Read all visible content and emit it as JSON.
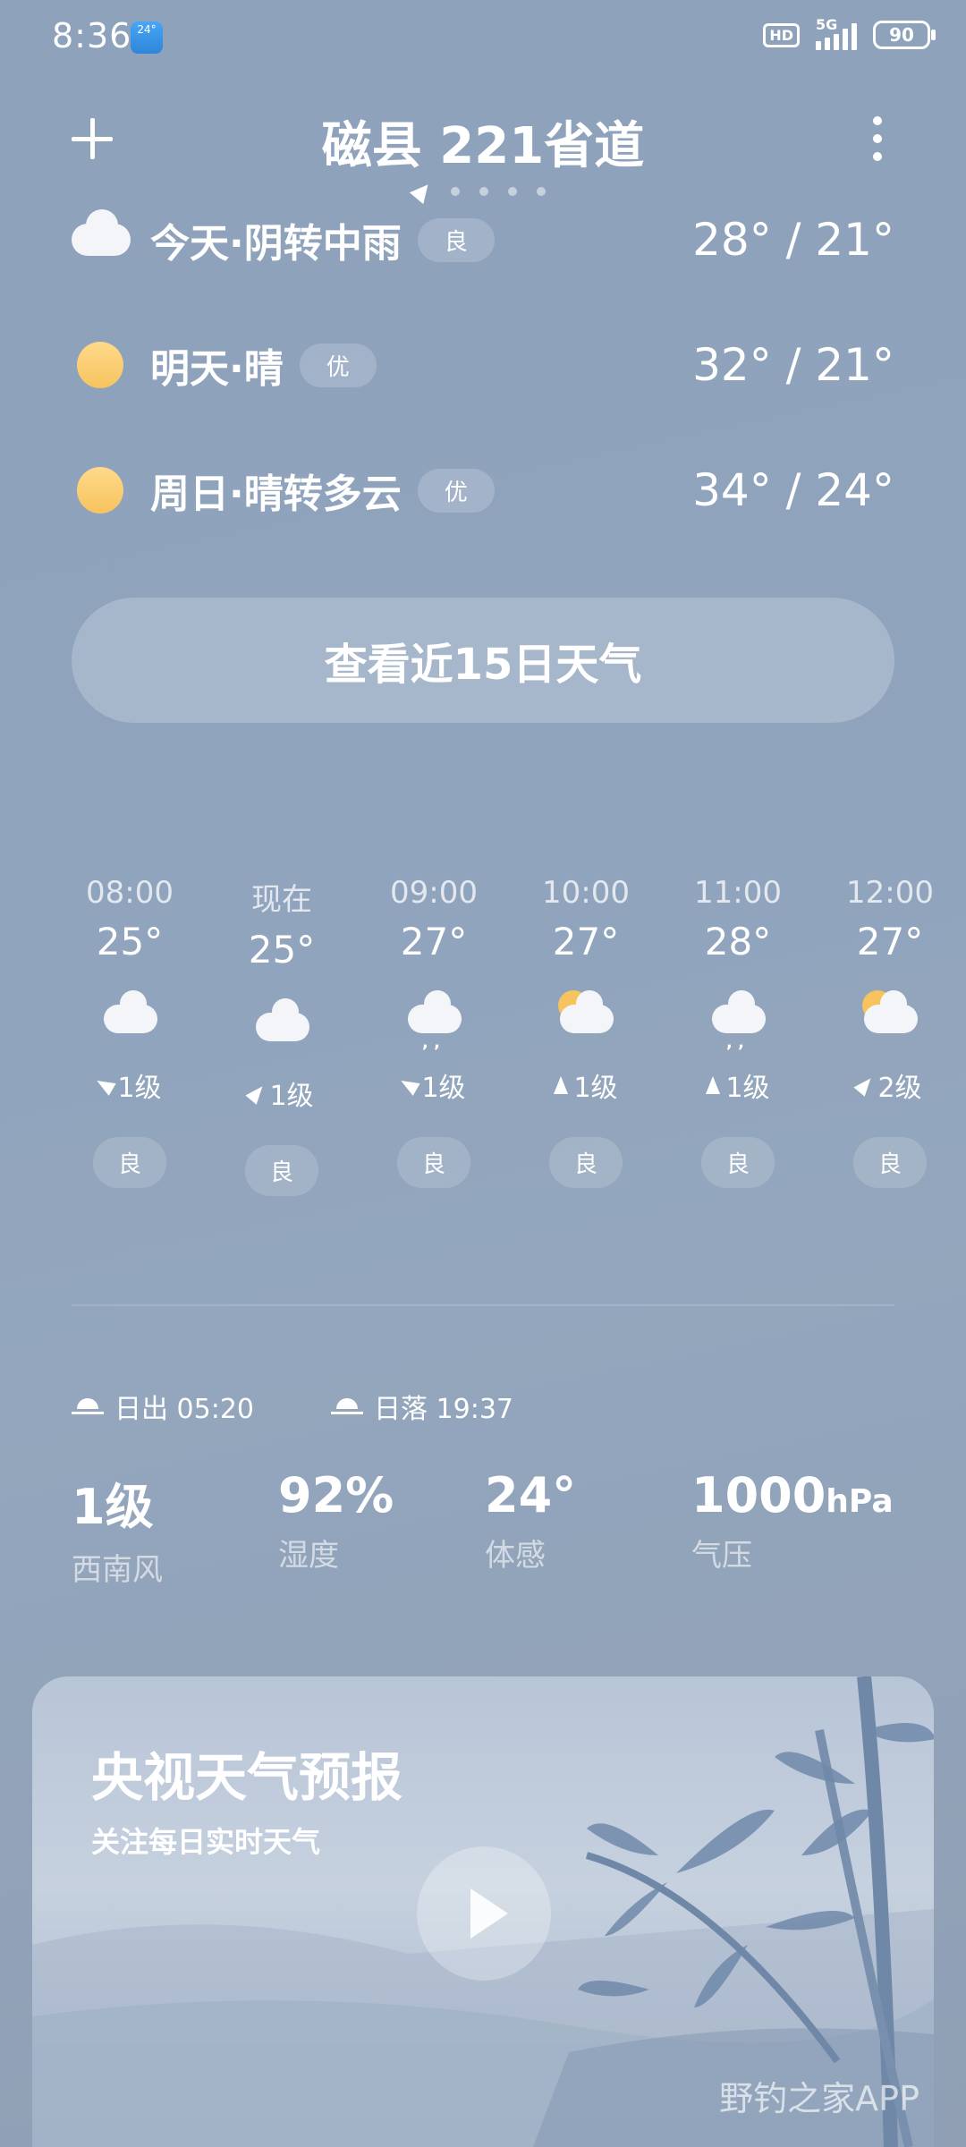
{
  "status_bar": {
    "time": "8:36",
    "weather_badge": "24°",
    "hd": "HD",
    "network": "5G",
    "battery": "90"
  },
  "header": {
    "city": "磁县 221省道"
  },
  "forecast": [
    {
      "label": "今天·阴转中雨",
      "aq": "良",
      "temp": "28° / 21°",
      "icon": "cloud-icon"
    },
    {
      "label": "明天·晴",
      "aq": "优",
      "temp": "32° / 21°",
      "icon": "sun-icon"
    },
    {
      "label": "周日·晴转多云",
      "aq": "优",
      "temp": "34° / 24°",
      "icon": "sun-icon"
    }
  ],
  "view15_label": "查看近15日天气",
  "hourly": [
    {
      "time": "08:00",
      "temp": "25°",
      "icon": "cloudy-icon",
      "wind": "1级",
      "aq": "良"
    },
    {
      "time": "现在",
      "temp": "25°",
      "icon": "cloudy-icon",
      "wind": "1级",
      "aq": "良"
    },
    {
      "time": "09:00",
      "temp": "27°",
      "icon": "rain-icon",
      "wind": "1级",
      "aq": "良"
    },
    {
      "time": "10:00",
      "temp": "27°",
      "icon": "partly-cloudy-icon",
      "wind": "1级",
      "aq": "良"
    },
    {
      "time": "11:00",
      "temp": "28°",
      "icon": "rain-icon",
      "wind": "1级",
      "aq": "良"
    },
    {
      "time": "12:00",
      "temp": "27°",
      "icon": "partly-cloudy-icon",
      "wind": "2级",
      "aq": "良"
    }
  ],
  "sun": {
    "sunrise": "日出 05:20",
    "sunset": "日落 19:37"
  },
  "details": {
    "wind_value": "1级",
    "wind_label": "西南风",
    "humidity_value": "92%",
    "humidity_label": "湿度",
    "feels_value": "24°",
    "feels_label": "体感",
    "pressure_value": "1000",
    "pressure_unit": "hPa",
    "pressure_label": "气压"
  },
  "video_card": {
    "title": "央视天气预报",
    "subtitle": "关注每日实时天气",
    "watermark": "野钓之家APP"
  }
}
